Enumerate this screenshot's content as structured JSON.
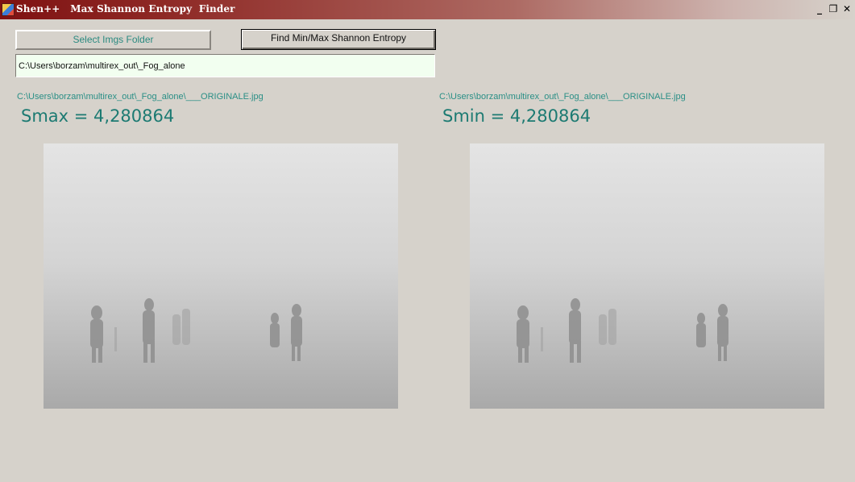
{
  "window": {
    "title": "Shen++   Max Shannon Entropy  Finder",
    "controls": {
      "minimize": "_",
      "restore": "❐",
      "close": "✕"
    }
  },
  "toolbar": {
    "select_folder_label": "Select Imgs Folder",
    "find_entropy_label": "Find Min/Max Shannon Entropy"
  },
  "folder_path": {
    "value": "C:\\Users\\borzam\\multirex_out\\_Fog_alone"
  },
  "max_panel": {
    "file_path": "C:\\Users\\borzam\\multirex_out\\_Fog_alone\\___ORIGINALE.jpg",
    "entropy_text": "Smax = 4,280864"
  },
  "min_panel": {
    "file_path": "C:\\Users\\borzam\\multirex_out\\_Fog_alone\\___ORIGINALE.jpg",
    "entropy_text": "Smin = 4,280864"
  },
  "colors": {
    "window_bg": "#d6d2cb",
    "accent_teal": "#1c7a72",
    "titlebar": "#7f1212",
    "input_bg": "#f2fff0"
  }
}
